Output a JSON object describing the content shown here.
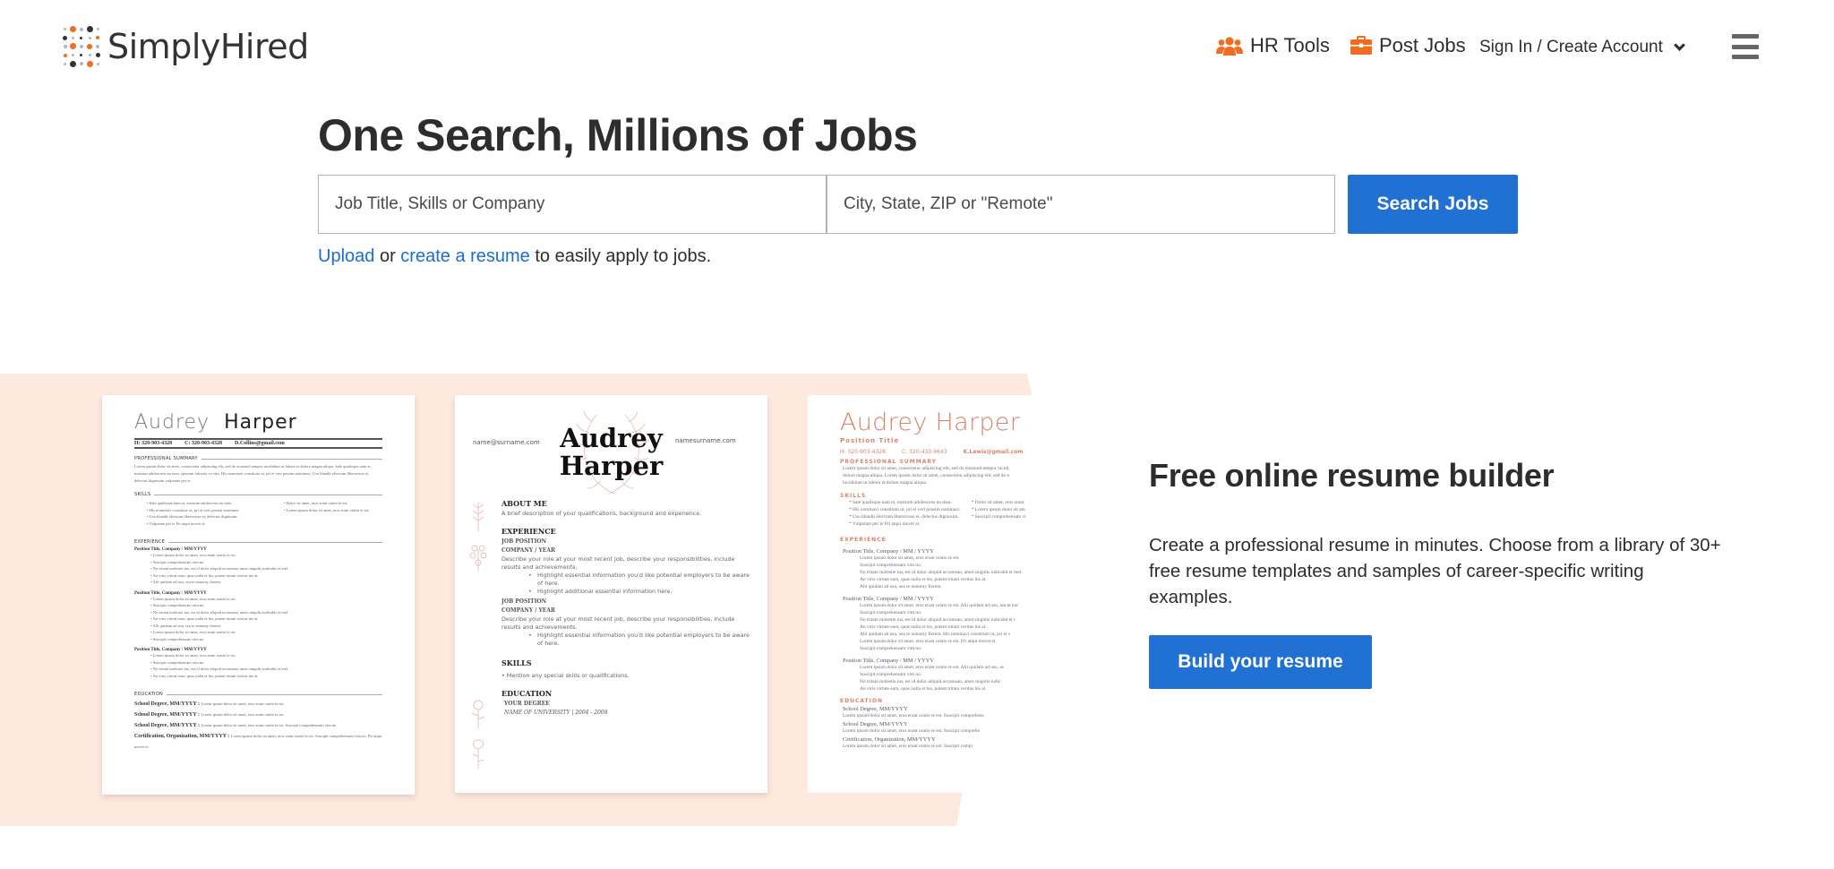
{
  "brand": {
    "name": "SimplyHired",
    "accent_orange": "#f26d21",
    "primary_blue": "#2170d3",
    "band_color": "#fde9de"
  },
  "nav": {
    "hr_tools": {
      "label": "HR Tools",
      "icon": "users-icon"
    },
    "post_jobs": {
      "label": "Post Jobs",
      "icon": "briefcase-icon"
    },
    "sign_in": {
      "label": "Sign In / Create Account",
      "icon": "chevron-down-icon"
    },
    "menu": {
      "icon": "hamburger-menu-icon"
    }
  },
  "hero": {
    "title": "One Search, Millions of Jobs",
    "job_input": {
      "placeholder": "Job Title, Skills or Company",
      "value": ""
    },
    "location_input": {
      "placeholder": "City, State, ZIP or \"Remote\"",
      "value": ""
    },
    "search_button": "Search Jobs",
    "upload_link": "Upload",
    "or_text": " or ",
    "create_link": "create a resume",
    "suffix_text": " to easily apply to jobs."
  },
  "resume_templates": [
    {
      "style": "classic",
      "first_name": "Audrey",
      "last_name": "Harper",
      "contact": [
        "H: 320-903-4328",
        "C: 320-903-4328",
        "D.Collins@gmail.com"
      ],
      "sections": {
        "summary_title": "PROFESSIONAL SUMMARY",
        "summary_text": "Lorem ipsum dolor sit amet, consectetur adipiscing elit, sed do eiusmod tempor incididunt ut labore et dolore magna aliqua. Sale qualisque nam ei, nostrum adolescens no mea, sperium lobortis cu vim. His nominavi constituto ut, pri ei veri possim nominavi. Usu blandit electram liberavisse ei, delectus dignissim vulputate per te.",
        "skills_title": "SKILLS",
        "skills_left": [
          "Sale qualisque nam ei, nostrum adolescens no mea.",
          "His nominavi constituto ut, pri ei veri possim nominavi.",
          "Usu blandit electram liberavisse ei, delectus dignissim.",
          "Vulputate per te Pri atqui movet ei."
        ],
        "skills_right": [
          "Dolor sit amet, eros erant oratio te est.",
          "Lorem ipsum dolor sit amet, eros erant oratio te est."
        ],
        "experience_title": "EXPERIENCE",
        "jobs": [
          {
            "title": "Position Title, Company / MM/YYYY",
            "bullets": [
              "Lorem ipsum dolor sit amet, eros erant oratio te est.",
              "Suscipit comprehensam vim no.",
              "No tritani molestie ius, est id dolor aliquid accumsan, amet singulis iudicabit et mel.",
              "An viris virtute eam, quas nulla et his, putent tritani veritus his at.",
              "Alii quidam ad usu, sea te nonumy fierent."
            ]
          },
          {
            "title": "Position Title, Company / MM/YYYY",
            "bullets": [
              "Lorem ipsum dolor sit amet, eros erant oratio te est.",
              "Suscipit comprehensam vim no.",
              "No tritani molestie ius, est id dolor aliquid accumsan, amet singulis iudicabit et mel.",
              "An viris virtute eam, quas nulla et his, putent tritani veritus his at.",
              "Alii quidam ad usu, sea te nonumy fierent.",
              "Lorem ipsum dolor sit amet, eros erant oratio te est.",
              "Suscipit comprehensam vim no."
            ]
          },
          {
            "title": "Position Title, Company / MM/YYYY",
            "bullets": [
              "Lorem ipsum dolor sit amet, eros erant oratio te est.",
              "Suscipit comprehensam vim no.",
              "No tritani molestie ius, est id dolor aliquid accumsan, amet singulis iudicabit et mel.",
              "An viris virtute eam, quas nulla et his, putent tritani veritus his at."
            ]
          }
        ],
        "education_title": "EDUCATION",
        "education": [
          {
            "label": "School Degree, MM/YYYY :",
            "text": "Lorem ipsum dolor sit amet, eros erant oratio te est."
          },
          {
            "label": "School Degree, MM/YYYY :",
            "text": "Lorem ipsum dolor sit amet, eros erant oratio te est."
          },
          {
            "label": "School Degree, MM/YYYY :",
            "text": "Lorem ipsum dolor sit amet, eros erant oratio te est. Suscipit comprehensam vim no."
          },
          {
            "label": "Certification, Organization, MM/YYYY :",
            "text": "Lorem ipsum dolor sit amet, eros erant oratio te est. Suscipit comprehensam vim no. Pri atqui movet ei."
          }
        ]
      }
    },
    {
      "style": "floral",
      "first_name": "Audrey",
      "last_name": "Harper",
      "email": "name@surname.com",
      "website": "namesurname.com",
      "sections": {
        "about_title": "ABOUT ME",
        "about_text": "A brief description of your qualifications, background and experience.",
        "experience_title": "EXPERIENCE",
        "jobs": [
          {
            "position": "JOB POSITION",
            "company": "COMPANY / YEAR",
            "description": "Describe your role at your most recent job, describe your responsibilities, include results and achievements.",
            "bullets": [
              "Highlight essential information you'd like potential employers to be aware of here.",
              "Highlight additional essential information here."
            ]
          },
          {
            "position": "JOB POSITION",
            "company": "COMPANY / YEAR",
            "description": "Describe your role at your most recent job, describe your responsibilities, include results and achievements.",
            "bullets": [
              "Highlight essential information you'd like potential employers to be aware of here."
            ]
          }
        ],
        "skills_title": "SKILLS",
        "skills_text": "• Mention any special skills or qualifications.",
        "education_title": "EDUCATION",
        "degree": "YOUR DEGREE",
        "university": "NAME OF UNIVERSITY | 2004 - 2008"
      }
    },
    {
      "style": "coral",
      "name": "Audrey Harper",
      "position": "Position Title",
      "contact": [
        "H: 320-903-4328",
        "C: 320-430-9643",
        "K.Lewis@gmail.com"
      ],
      "sections": {
        "summary_title": "PROFESSIONAL SUMMARY",
        "summary_text": [
          "Lorem ipsum dolor sit amet, consectetur adipiscing elit, sed do eiusmod tempor incidi",
          "dolore magna aliqua. Lorem ipsum dolor sit amet, consectetur adipiscing elit, sed do e",
          "incididunt ut labore et dolore magna aliqua."
        ],
        "skills_title": "SKILLS",
        "skills_left": [
          "* Sale qualisque nam ei, nostrum adolescens no mea.",
          "* His nominavi constituto ut, pri ei veri possim nominavi.",
          "* Usu blandit electram liberavisse ei, delectus dignissim.",
          "* Vulputate per te Pri atqui movet ei."
        ],
        "skills_right": [
          "* Dolor sit amet, eros erant",
          "* Lorem ipsum dolor sit am",
          "* Suscipit comprehensam vi"
        ],
        "experience_title": "EXPERIENCE",
        "jobs": [
          {
            "title": "Position Title, Company / MM / YYYY",
            "lines": [
              "Lorem ipsum dolor sit amet, eros erant oratio te est.",
              "Suscipit comprehensam vim no.",
              "No tritani molestie ius, est id dolor aliquid accumsan, amet singulis iudicabit et mel.",
              "An viris virtute eam, quas nulla et his, putent tritani veritus his at.",
              "Alii quidam ad usu, sea te nonumy fierent."
            ]
          },
          {
            "title": "Position Title, Company / MM / YYYY",
            "lines": [
              "Lorem ipsum dolor sit amet, eros erant oratio te est. Alii quidam ad usu, sea te nor",
              "Suscipit comprehensam vim no.",
              "No tritani molestie ius, est id dolor aliquid accumsan, amet singulis iudicabit et r",
              "An viris virtute eam, quas nulla et his, putent tritani veritus his at.",
              "Alii quidam ad usu, sea te nonumy fierent. His nominavi constituto ut, pri ei v",
              "Lorem ipsum dolor sit amet, eros erant oratio te est. Pri atqui movet ei.",
              "Suscipit comprehensam vim no."
            ]
          },
          {
            "title": "Position Title, Company / MM / YYYY",
            "lines": [
              "Lorem ipsum dolor sit amet, eros erant oratio te est. Alii quidam ad usu, se",
              "Suscipit comprehensam vim no.",
              "No tritani molestie ius, est id dolor aliquid accumsan, amet singulis iudic",
              "An viris virtute eam, quas nulla et his, putent tritani veritus his at."
            ]
          }
        ],
        "education_title": "EDUCATION",
        "education": [
          {
            "label": "School Degree, MM/YYYY",
            "text": "Lorem ipsum dolor sit amet, eros erant oratio te est. Suscipit comprehens"
          },
          {
            "label": "School Degree, MM/YYYY",
            "text": "Lorem ipsum dolor sit amet, eros erant oratio te est. Suscipit comprehe"
          },
          {
            "label": "Certification, Organization, MM/YYYY",
            "text": "Lorem ipsum dolor sit amet, eros erant oratio te est. Suscipit compr"
          }
        ]
      }
    }
  ],
  "promo": {
    "title": "Free online resume builder",
    "text": "Create a professional resume in minutes. Choose from a library of 30+ free resume templates and samples of career-specific writing examples.",
    "button": "Build your resume"
  }
}
